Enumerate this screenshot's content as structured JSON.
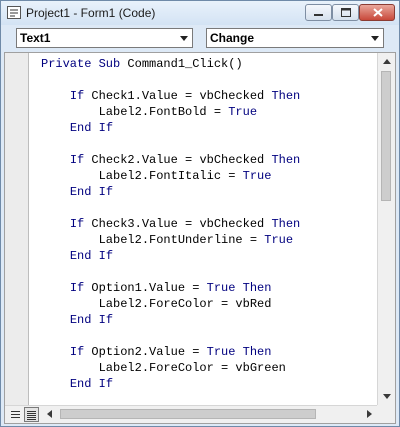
{
  "window": {
    "title": "Project1 - Form1 (Code)",
    "icon": "vb-code-window-icon",
    "controls": {
      "minimize": "minimize-icon",
      "maximize": "maximize-icon",
      "close": "close-icon"
    }
  },
  "selectors": {
    "object_value": "Text1",
    "procedure_value": "Change"
  },
  "code": {
    "keyword_color": "#00007f",
    "lines": [
      [
        {
          "t": "Private Sub",
          "k": true
        },
        {
          "t": " Command1_Click()"
        }
      ],
      [],
      [
        {
          "t": "    "
        },
        {
          "t": "If",
          "k": true
        },
        {
          "t": " Check1.Value = vbChecked "
        },
        {
          "t": "Then",
          "k": true
        }
      ],
      [
        {
          "t": "        Label2.FontBold = "
        },
        {
          "t": "True",
          "k": true
        }
      ],
      [
        {
          "t": "    "
        },
        {
          "t": "End If",
          "k": true
        }
      ],
      [],
      [
        {
          "t": "    "
        },
        {
          "t": "If",
          "k": true
        },
        {
          "t": " Check2.Value = vbChecked "
        },
        {
          "t": "Then",
          "k": true
        }
      ],
      [
        {
          "t": "        Label2.FontItalic = "
        },
        {
          "t": "True",
          "k": true
        }
      ],
      [
        {
          "t": "    "
        },
        {
          "t": "End If",
          "k": true
        }
      ],
      [],
      [
        {
          "t": "    "
        },
        {
          "t": "If",
          "k": true
        },
        {
          "t": " Check3.Value = vbChecked "
        },
        {
          "t": "Then",
          "k": true
        }
      ],
      [
        {
          "t": "        Label2.FontUnderline = "
        },
        {
          "t": "True",
          "k": true
        }
      ],
      [
        {
          "t": "    "
        },
        {
          "t": "End If",
          "k": true
        }
      ],
      [],
      [
        {
          "t": "    "
        },
        {
          "t": "If",
          "k": true
        },
        {
          "t": " Option1.Value = "
        },
        {
          "t": "True Then",
          "k": true
        }
      ],
      [
        {
          "t": "        Label2.ForeColor = vbRed"
        }
      ],
      [
        {
          "t": "    "
        },
        {
          "t": "End If",
          "k": true
        }
      ],
      [],
      [
        {
          "t": "    "
        },
        {
          "t": "If",
          "k": true
        },
        {
          "t": " Option2.Value = "
        },
        {
          "t": "True Then",
          "k": true
        }
      ],
      [
        {
          "t": "        Label2.ForeColor = vbGreen"
        }
      ],
      [
        {
          "t": "    "
        },
        {
          "t": "End If",
          "k": true
        }
      ]
    ]
  },
  "status_bar": {
    "procedure_view_icon": "procedure-view-icon",
    "full_module_view_icon": "full-module-view-icon"
  }
}
